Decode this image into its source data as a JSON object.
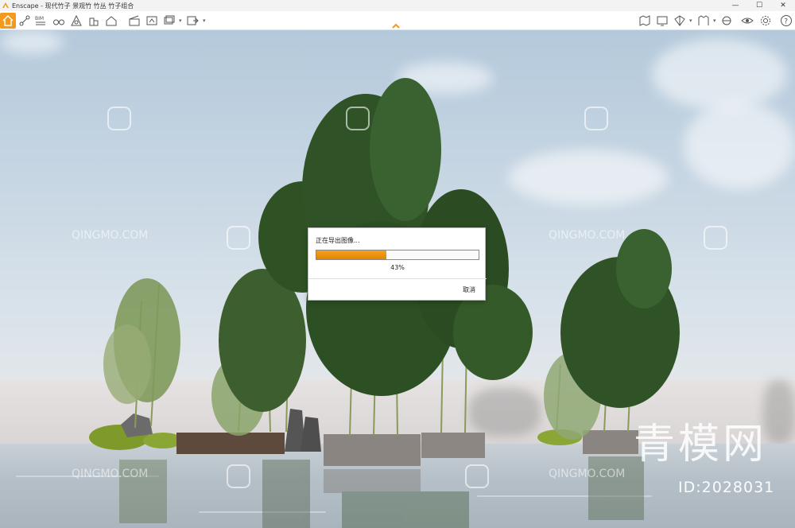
{
  "titlebar": {
    "title": "Enscape - 现代竹子 景观竹 竹丛 竹子组合",
    "minimize": "—",
    "maximize": "☐",
    "close": "✕"
  },
  "toolbar": {
    "left_icons": [
      "home-icon",
      "bim-path-icon",
      "bim-icon",
      "binoculars-icon",
      "fly-mode-icon",
      "sun-icon",
      "building-icon",
      "clapper-icon",
      "screenshot-icon",
      "batch-render-icon",
      "panorama-icon",
      "export-icon"
    ],
    "right_icons": [
      "map-icon",
      "display-icon",
      "asset-icon",
      "materials-icon",
      "atmosphere-icon",
      "eye-icon",
      "settings-icon",
      "help-icon"
    ],
    "collapse_label": "^"
  },
  "dialog": {
    "title": "正在导出图像...",
    "progress_percent": 43,
    "progress_text": "43%",
    "cancel_label": "取消"
  },
  "watermark": {
    "brand_text": "QINGMO.COM",
    "big_text": "青模网",
    "id_text": "ID:2028031"
  },
  "colors": {
    "accent": "#f39a1e",
    "progress": "#e68a0a",
    "sky": "#c2d3e1"
  }
}
